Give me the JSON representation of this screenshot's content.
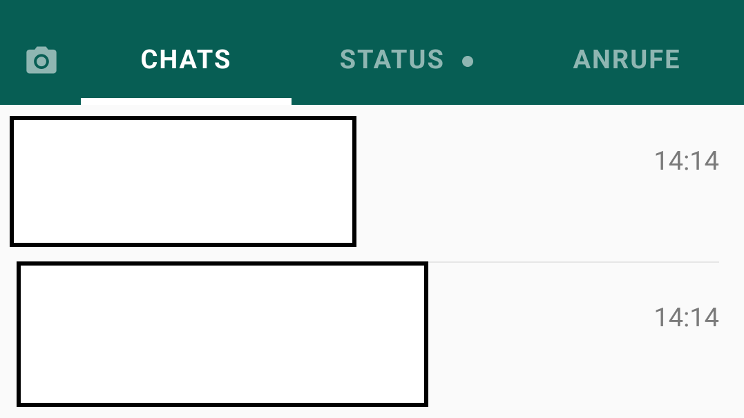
{
  "tabs": {
    "chats": "CHATS",
    "status": "STATUS",
    "calls": "ANRUFE"
  },
  "chats": [
    {
      "time": "14:14"
    },
    {
      "time": "14:14"
    }
  ]
}
